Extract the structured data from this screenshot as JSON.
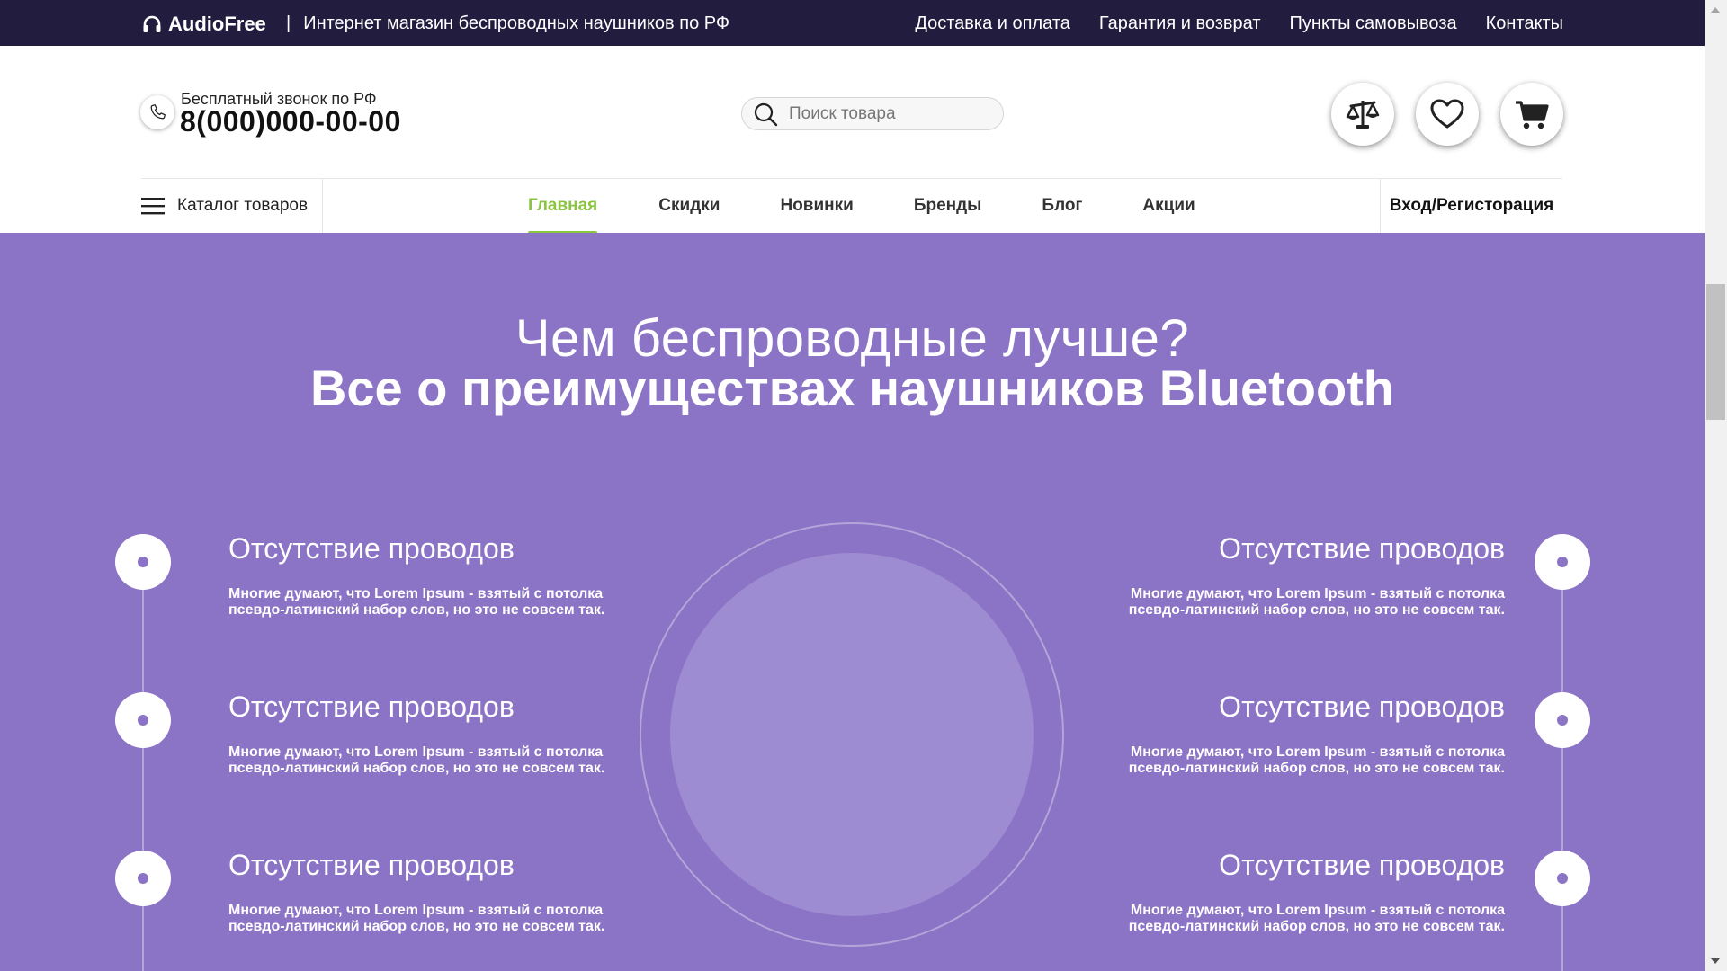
{
  "topbar": {
    "brand": "AudioFree",
    "separator": "|",
    "tagline": "Интернет магазин беспроводных наушников по РФ",
    "nav": [
      "Доставка и оплата",
      "Гарантия и возврат",
      "Пункты самовывоза",
      "Контакты"
    ]
  },
  "header": {
    "phone_caption": "Бесплатный звонок по РФ",
    "phone_number": "8(000)000-00-00",
    "search_placeholder": "Поиск товара",
    "buttons": [
      "compare-icon",
      "heart-icon",
      "cart-icon"
    ]
  },
  "nav": {
    "catalog_label": "Каталог товаров",
    "items": [
      {
        "label": "Главная",
        "active": true
      },
      {
        "label": "Скидки",
        "active": false
      },
      {
        "label": "Новинки",
        "active": false
      },
      {
        "label": "Бренды",
        "active": false
      },
      {
        "label": "Блог",
        "active": false
      },
      {
        "label": "Акции",
        "active": false
      }
    ],
    "login_label": "Вход/Регисторация"
  },
  "hero": {
    "subtitle": "Чем беспроводные лучше?",
    "title": "Все о преимуществах наушников Bluetooth",
    "features_left": [
      {
        "title": "Отсутствие проводов",
        "text_line1": "Многие думают, что Lorem Ipsum - взятый с потолка",
        "text_line2": "псевдо-латинский набор слов, но это не совсем так."
      },
      {
        "title": "Отсутствие проводов",
        "text_line1": "Многие думают, что Lorem Ipsum - взятый с потолка",
        "text_line2": "псевдо-латинский набор слов, но это не совсем так."
      },
      {
        "title": "Отсутствие проводов",
        "text_line1": "Многие думают, что Lorem Ipsum - взятый с потолка",
        "text_line2": "псевдо-латинский набор слов, но это не совсем так."
      }
    ],
    "features_right": [
      {
        "title": "Отсутствие проводов",
        "text_line1": "Многие думают, что Lorem Ipsum - взятый с потолка",
        "text_line2": "псевдо-латинский набор слов, но это не совсем так."
      },
      {
        "title": "Отсутствие проводов",
        "text_line1": "Многие думают, что Lorem Ipsum - взятый с потолка",
        "text_line2": "псевдо-латинский набор слов, но это не совсем так."
      },
      {
        "title": "Отсутствие проводов",
        "text_line1": "Многие думают, что Lorem Ipsum - взятый с потолка",
        "text_line2": "псевдо-латинский набор слов, но это не совсем так."
      }
    ]
  },
  "colors": {
    "topbar_bg": "#221c3f",
    "hero_bg": "#8b73c5",
    "accent_green": "#8bc53f"
  }
}
